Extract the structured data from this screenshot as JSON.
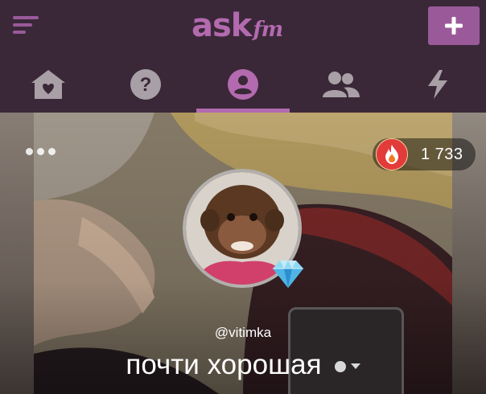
{
  "header": {
    "logo_main": "ask",
    "logo_suffix": "fm",
    "brand_color": "#b36aaf",
    "bar_color": "#3a2838",
    "menu_icon": "hamburger-icon",
    "add_icon": "plus-icon"
  },
  "nav": {
    "active_index": 2,
    "tabs": [
      {
        "icon": "home-heart-icon"
      },
      {
        "icon": "question-icon"
      },
      {
        "icon": "profile-icon"
      },
      {
        "icon": "friends-icon"
      },
      {
        "icon": "lightning-icon"
      }
    ]
  },
  "profile": {
    "fire_count": "1 733",
    "fire_icon": "fire-icon",
    "more_icon": "more-dots-icon",
    "verified_icon": "diamond-icon",
    "username": "@vitimka",
    "display_name": "почти хорошая"
  }
}
